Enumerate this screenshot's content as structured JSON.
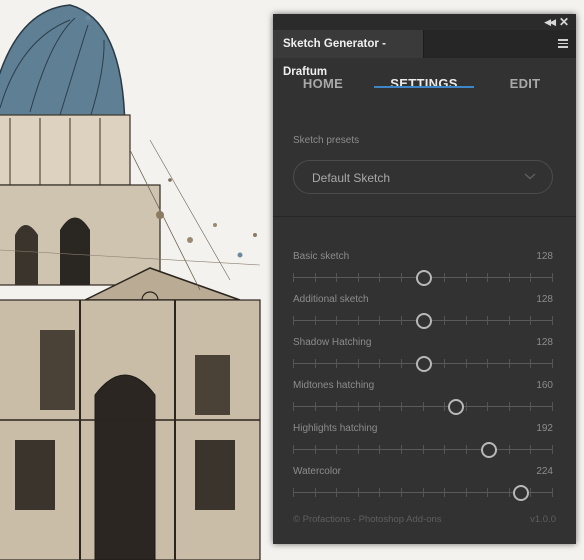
{
  "panel": {
    "title": "Sketch Generator - Draftum",
    "collapse_icon": "double-chevron-icon",
    "close_icon": "close-icon",
    "menu_icon": "hamburger-menu-icon"
  },
  "nav": {
    "tabs": [
      {
        "label": "HOME"
      },
      {
        "label": "SETTINGS"
      },
      {
        "label": "EDIT"
      }
    ],
    "active": "SETTINGS",
    "accent_color": "#3e86c8"
  },
  "presets": {
    "label": "Sketch presets",
    "selected": "Default Sketch"
  },
  "sliders": [
    {
      "label": "Basic sketch",
      "value": "128",
      "fraction": 0.502
    },
    {
      "label": "Additional sketch",
      "value": "128",
      "fraction": 0.502
    },
    {
      "label": "Shadow Hatching",
      "value": "128",
      "fraction": 0.502
    },
    {
      "label": "Midtones hatching",
      "value": "160",
      "fraction": 0.627
    },
    {
      "label": "Highlights hatching",
      "value": "192",
      "fraction": 0.753
    },
    {
      "label": "Watercolor",
      "value": "224",
      "fraction": 0.878
    }
  ],
  "footer": {
    "credit": "© Profactions - Photoshop Add-ons",
    "version": "v1.0.0"
  }
}
